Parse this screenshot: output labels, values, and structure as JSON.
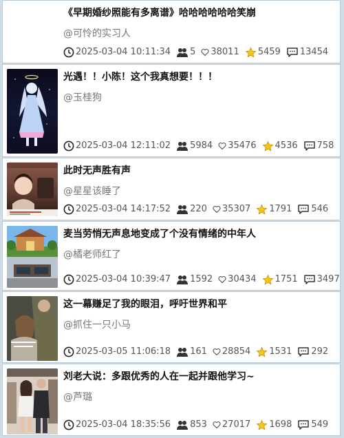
{
  "items": [
    {
      "title": "《早期婚纱照能有多离谱》哈哈哈哈哈哈笑崩",
      "author": "@可怜的实习人",
      "time": "2025-03-04 10:11:34",
      "followers": "5",
      "likes": "38011",
      "stars": "5459",
      "comments": "13454",
      "has_thumb": false
    },
    {
      "title": "光遇！！小陈！这个我真想要！！！",
      "author": "@玉桂狗",
      "time": "2025-03-04 12:11:02",
      "followers": "5984",
      "likes": "35476",
      "stars": "4536",
      "comments": "758",
      "has_thumb": true
    },
    {
      "title": "此时无声胜有声",
      "author": "@星星该睡了",
      "time": "2025-03-04 14:17:52",
      "followers": "220",
      "likes": "35307",
      "stars": "1791",
      "comments": "546",
      "has_thumb": true
    },
    {
      "title": "麦当劳悄无声息地变成了个没有情绪的中年人",
      "author": "@橘老师红了",
      "time": "2025-03-04 10:39:47",
      "followers": "1592",
      "likes": "30434",
      "stars": "1751",
      "comments": "3497",
      "has_thumb": true
    },
    {
      "title": "这一幕赚足了我的眼泪，呼吁世界和平",
      "author": "@抓住一只小马",
      "time": "2025-03-05 11:06:18",
      "followers": "161",
      "likes": "28854",
      "stars": "1531",
      "comments": "292",
      "has_thumb": true
    },
    {
      "title": "刘老大说：多跟优秀的人在一起并跟他学习~",
      "author": "@芦璐",
      "time": "2025-03-04 18:35:56",
      "followers": "853",
      "likes": "27017",
      "stars": "1698",
      "comments": "549",
      "has_thumb": true
    }
  ],
  "colors": {
    "star": "#f5c518",
    "background": "#cfdde8"
  }
}
